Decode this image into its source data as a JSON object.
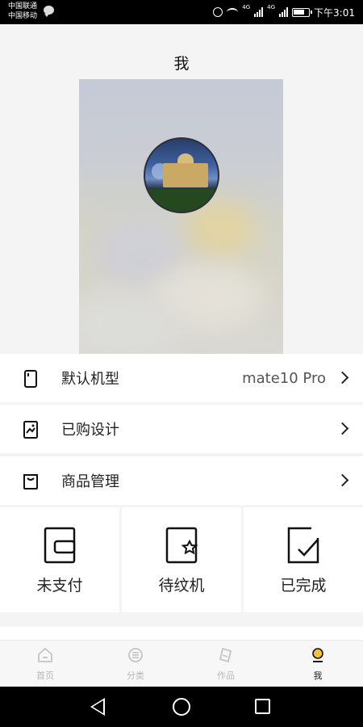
{
  "status_bar": {
    "carrier_1": "中国联通",
    "carrier_2": "中国移动",
    "network_1": "4G",
    "network_2": "4G",
    "time": "下午3:01",
    "icons": [
      "chat-icon",
      "alarm-icon",
      "wifi-icon",
      "signal-icon",
      "battery-icon"
    ]
  },
  "header": {
    "title": "我"
  },
  "profile": {
    "cover": "blurred-photo-background",
    "avatar": "palace-at-night-photo"
  },
  "menu": [
    {
      "icon": "phone-icon",
      "label": "默认机型",
      "value": "mate10 Pro"
    },
    {
      "icon": "image-icon",
      "label": "已购设计",
      "value": ""
    },
    {
      "icon": "bag-icon",
      "label": "商品管理",
      "value": ""
    }
  ],
  "orders": [
    {
      "icon": "wallet-icon",
      "label": "未支付"
    },
    {
      "icon": "star-box-icon",
      "label": "待纹机"
    },
    {
      "icon": "check-box-icon",
      "label": "已完成"
    }
  ],
  "tabs": [
    {
      "icon": "home-icon",
      "label": "首页",
      "active": false
    },
    {
      "icon": "category-icon",
      "label": "分类",
      "active": false
    },
    {
      "icon": "works-icon",
      "label": "作品",
      "active": false
    },
    {
      "icon": "me-icon",
      "label": "我",
      "active": true
    }
  ],
  "colors": {
    "accent": "#111111",
    "inactive_tab": "#b8b8b8",
    "page_bg": "#f4f4f4",
    "card_bg": "#ffffff"
  }
}
